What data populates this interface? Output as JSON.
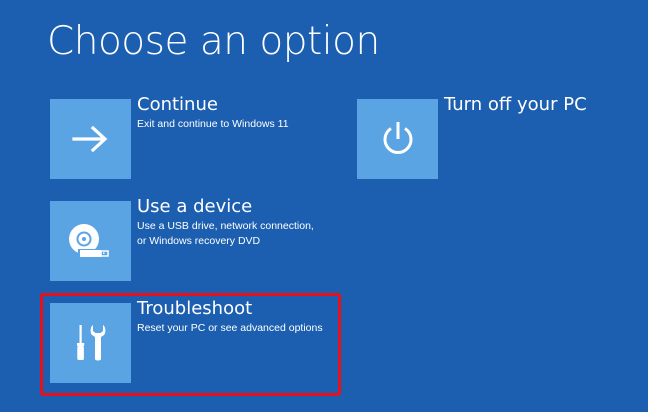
{
  "page": {
    "title": "Choose an option"
  },
  "options": {
    "continue": {
      "label": "Continue",
      "description": "Exit and continue to Windows 11",
      "icon": "arrow-right-icon"
    },
    "use_device": {
      "label": "Use a device",
      "description_lines": [
        "Use a USB drive, network connection,",
        "or Windows recovery DVD"
      ],
      "icon": "disc-usb-icon"
    },
    "troubleshoot": {
      "label": "Troubleshoot",
      "description": "Reset your PC or see advanced options",
      "icon": "screwdriver-wrench-icon"
    },
    "turn_off": {
      "label": "Turn off your PC",
      "icon": "power-icon"
    }
  },
  "colors": {
    "background": "#1c5fb0",
    "tile": "#5aa4e4",
    "highlight": "#e8101b",
    "text": "#ffffff"
  },
  "highlight": {
    "target": "troubleshoot"
  }
}
